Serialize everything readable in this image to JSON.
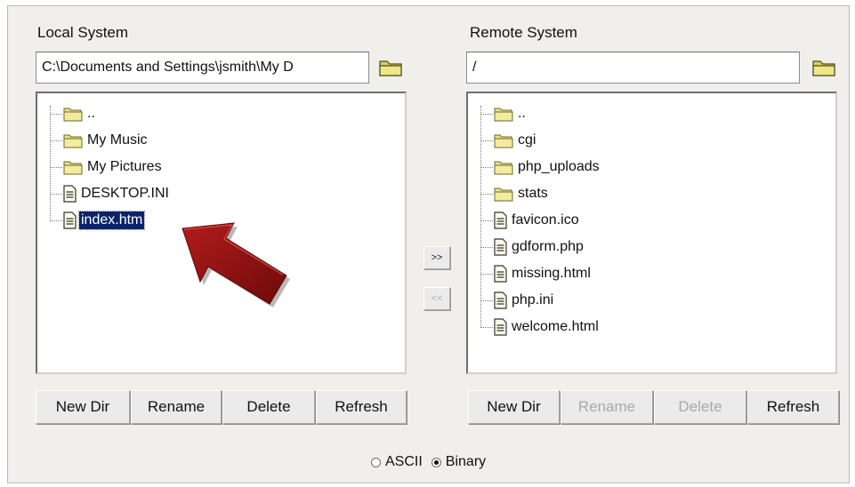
{
  "local": {
    "label": "Local System",
    "path": "C:\\Documents and Settings\\jsmith\\My D",
    "items": [
      {
        "name": "..",
        "type": "folder"
      },
      {
        "name": "My Music",
        "type": "folder"
      },
      {
        "name": "My Pictures",
        "type": "folder"
      },
      {
        "name": "DESKTOP.INI",
        "type": "file"
      },
      {
        "name": "index.htm",
        "type": "file",
        "selected": true
      }
    ],
    "buttons": {
      "new_dir": "New Dir",
      "rename": "Rename",
      "delete": "Delete",
      "refresh": "Refresh"
    }
  },
  "remote": {
    "label": "Remote System",
    "path": "/",
    "items": [
      {
        "name": "..",
        "type": "folder"
      },
      {
        "name": "cgi",
        "type": "folder"
      },
      {
        "name": "php_uploads",
        "type": "folder"
      },
      {
        "name": "stats",
        "type": "folder"
      },
      {
        "name": "favicon.ico",
        "type": "file"
      },
      {
        "name": "gdform.php",
        "type": "file"
      },
      {
        "name": "missing.html",
        "type": "file"
      },
      {
        "name": "php.ini",
        "type": "file"
      },
      {
        "name": "welcome.html",
        "type": "file"
      }
    ],
    "buttons": {
      "new_dir": "New Dir",
      "rename": "Rename",
      "delete": "Delete",
      "refresh": "Refresh"
    },
    "disabled_buttons": [
      "rename",
      "delete"
    ]
  },
  "transfer": {
    "upload_label": ">>",
    "download_label": "<<",
    "download_disabled": true
  },
  "mode": {
    "ascii_label": "ASCII",
    "binary_label": "Binary",
    "selected": "binary"
  },
  "icons": {
    "folder": "folder-icon",
    "file": "file-icon",
    "browse": "folder-browse-icon",
    "pointer": "arrow-pointer-icon"
  },
  "colors": {
    "selection": "#0a246a",
    "folder": "#e9e28b",
    "arrow": "#8c1414"
  }
}
